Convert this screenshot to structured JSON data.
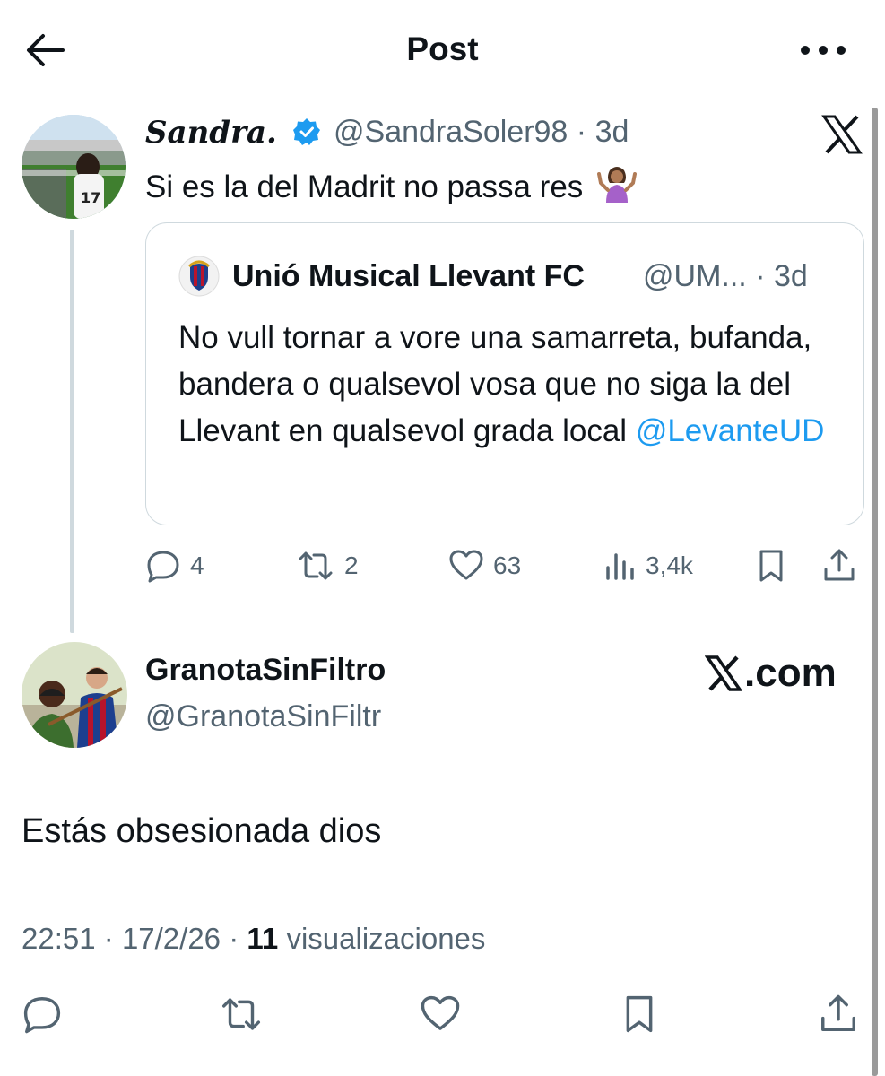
{
  "header": {
    "title": "Post"
  },
  "quoting_post": {
    "display_name": "Sandra.",
    "handle": "@SandraSoler98",
    "age": "3d",
    "separator": "·",
    "text": "Si es la del Madrit no passa res",
    "verified": true,
    "emoji": "person-shrugging",
    "quoted_post": {
      "display_name": "Unió Musical Llevant FC",
      "handle": "@UM...",
      "age": "3d",
      "text": "No vull tornar a vore una samarreta, bufanda, bandera o qualsevol vosa que no siga la del Llevant en qualsevol grada local",
      "mention": "@LevanteUD"
    },
    "stats": {
      "replies": "4",
      "reposts": "2",
      "likes": "63",
      "views": "3,4k"
    }
  },
  "main_post": {
    "display_name": "GranotaSinFiltro",
    "handle": "@GranotaSinFiltr",
    "text": "Estás obsesionada dios",
    "time": "22:51",
    "date": "17/2/26",
    "views_count": "11",
    "views_label": "visualizaciones"
  },
  "watermark": {
    "text": ".com"
  },
  "colors": {
    "text": "#0f1419",
    "secondary": "#536471",
    "link": "#1d9bf0",
    "verified": "#1d9bf0",
    "border": "#cfd9de"
  }
}
